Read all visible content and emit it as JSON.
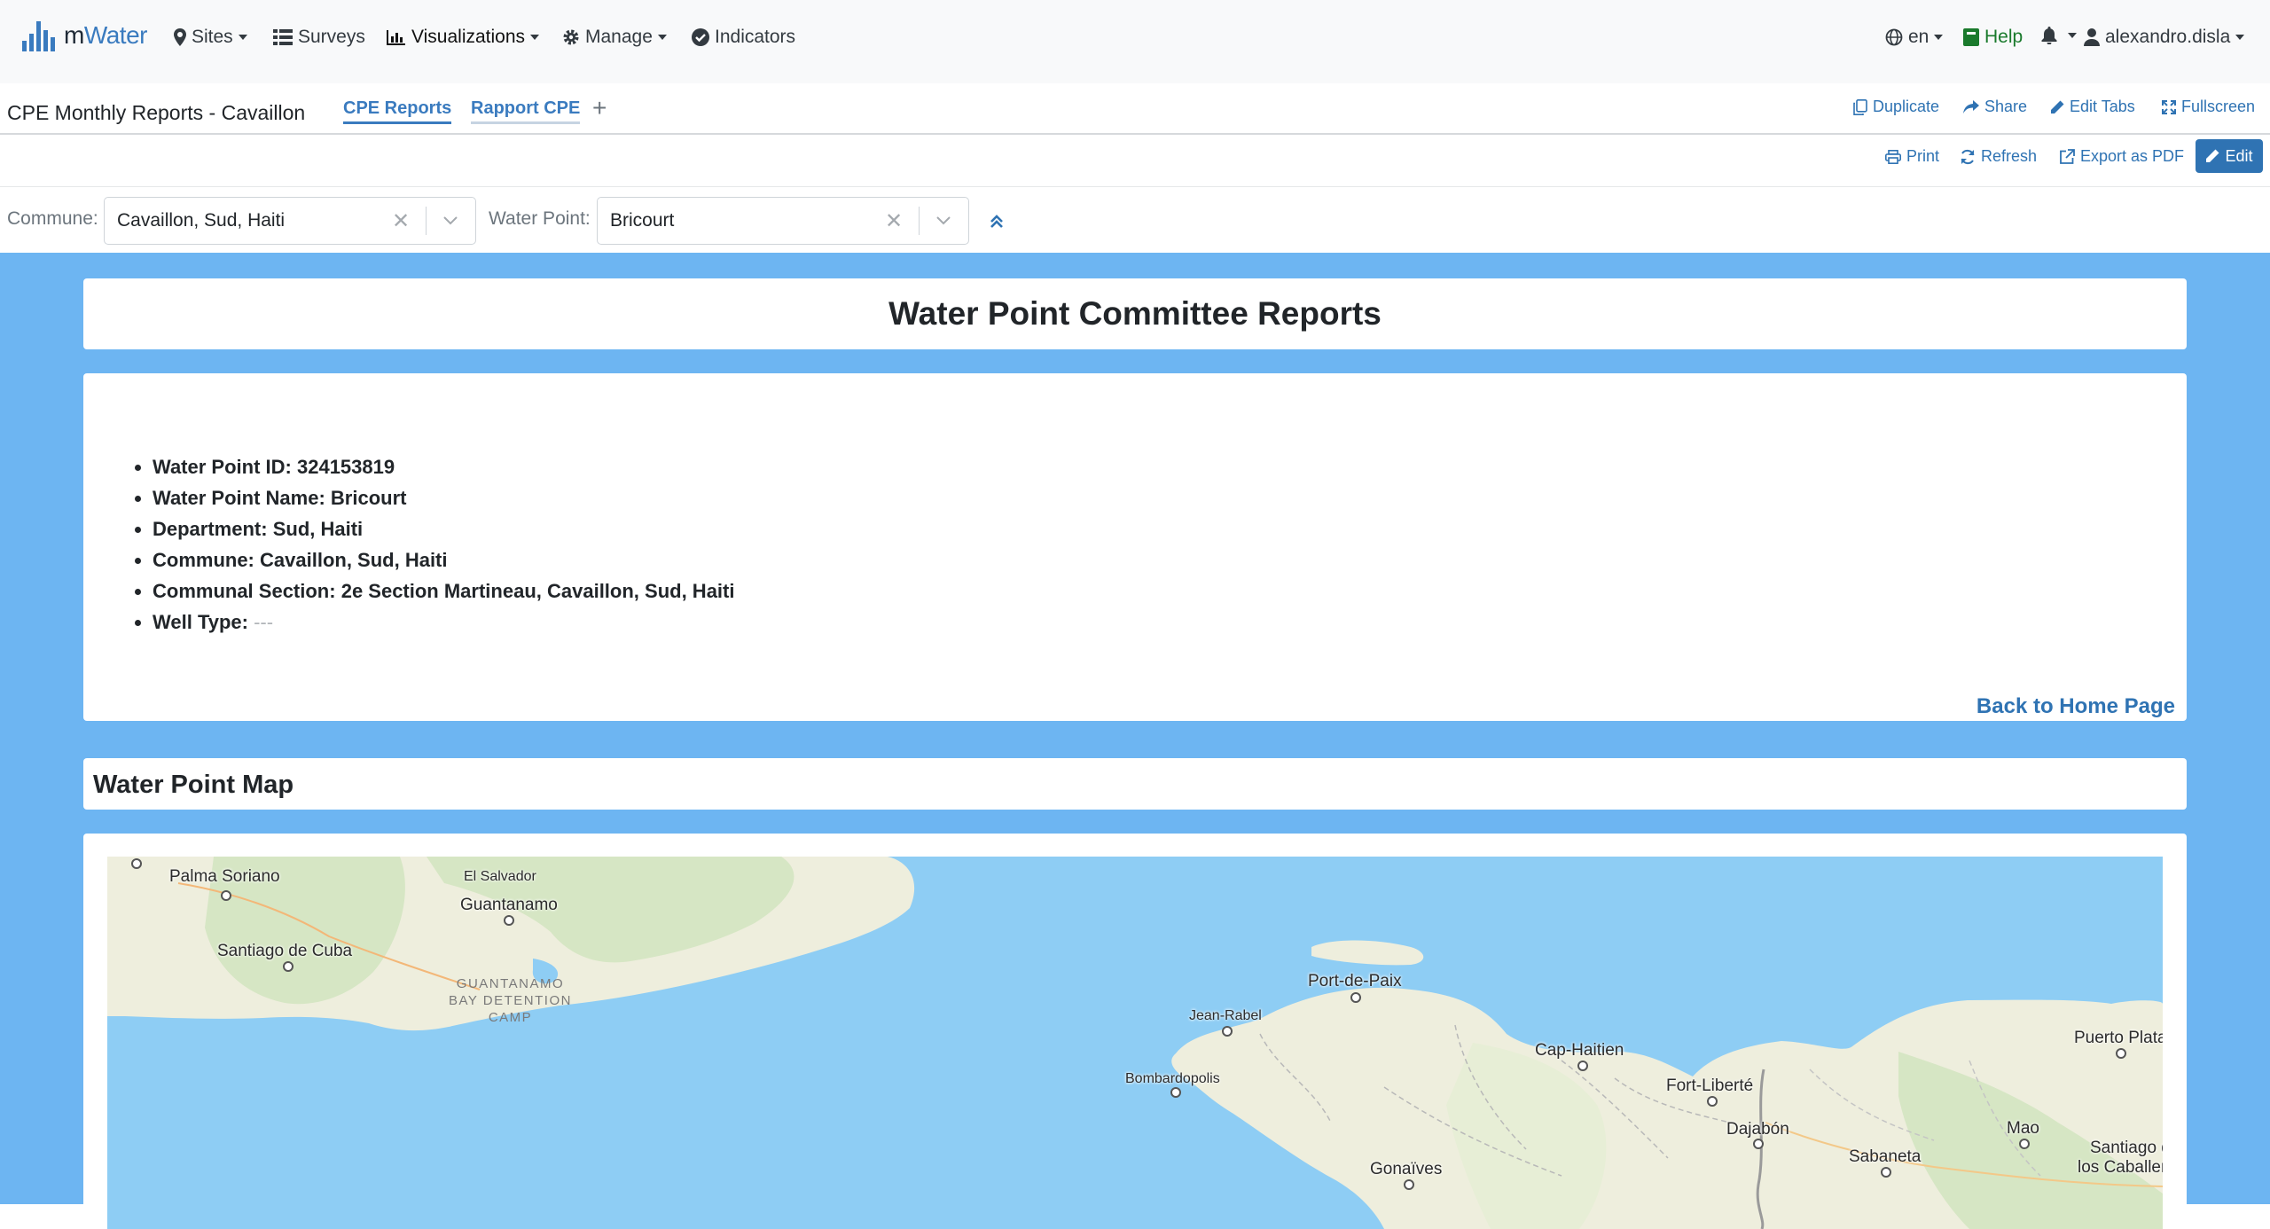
{
  "brand": {
    "name_m": "m",
    "name_rest": "Water"
  },
  "nav": {
    "sites": "Sites",
    "surveys": "Surveys",
    "visualizations": "Visualizations",
    "manage": "Manage",
    "indicators": "Indicators",
    "language": "en",
    "help": "Help",
    "user": "alexandro.disla"
  },
  "report": {
    "title": "CPE Monthly Reports - Cavaillon",
    "tabs": [
      {
        "label": "CPE Reports",
        "active": true
      },
      {
        "label": "Rapport CPE",
        "active": false
      }
    ],
    "add_tab": "+",
    "actions": {
      "duplicate": "Duplicate",
      "share": "Share",
      "edit_tabs": "Edit Tabs",
      "fullscreen": "Fullscreen"
    }
  },
  "toolbar": {
    "print": "Print",
    "refresh": "Refresh",
    "export_pdf": "Export as PDF",
    "edit": "Edit"
  },
  "filters": {
    "commune": {
      "label": "Commune:",
      "value": "Cavaillon, Sud, Haiti"
    },
    "water_point": {
      "label": "Water Point:",
      "value": "Bricourt"
    }
  },
  "dashboard": {
    "title": "Water Point Committee Reports",
    "info": [
      {
        "label": "Water Point ID:",
        "value": "324153819"
      },
      {
        "label": "Water Point Name:",
        "value": "Bricourt"
      },
      {
        "label": "Department:",
        "value": "Sud, Haiti"
      },
      {
        "label": "Commune:",
        "value": "Cavaillon, Sud, Haiti"
      },
      {
        "label": "Communal Section:",
        "value": "2e Section Martineau, Cavaillon, Sud, Haiti"
      },
      {
        "label": "Well Type:",
        "value": "---"
      }
    ],
    "back_link": "Back to Home Page",
    "map_section_title": "Water Point Map"
  },
  "map": {
    "places": {
      "palma_soriano": "Palma Soriano",
      "el_salvador": "El Salvador",
      "guantanamo": "Guantanamo",
      "santiago_de_cuba": "Santiago de Cuba",
      "guantanamo_bay_line1": "GUANTANAMO",
      "guantanamo_bay_line2": "BAY DETENTION",
      "guantanamo_bay_line3": "CAMP",
      "port_de_paix": "Port-de-Paix",
      "jean_rabel": "Jean-Rabel",
      "cap_haitien": "Cap-Haitien",
      "puerto_plata": "Puerto Plata",
      "bombardopolis": "Bombardopolis",
      "fort_liberte": "Fort-Liberté",
      "dajabon": "Dajabón",
      "mao": "Mao",
      "sabaneta": "Sabaneta",
      "santiago_de_line1": "Santiago de",
      "santiago_de_line2": "los Caballeros",
      "gonaives": "Gonaïves"
    },
    "colors": {
      "water": "#8ecdf4",
      "land": "#eeeedd",
      "vegetation": "#d6e6c4"
    }
  }
}
